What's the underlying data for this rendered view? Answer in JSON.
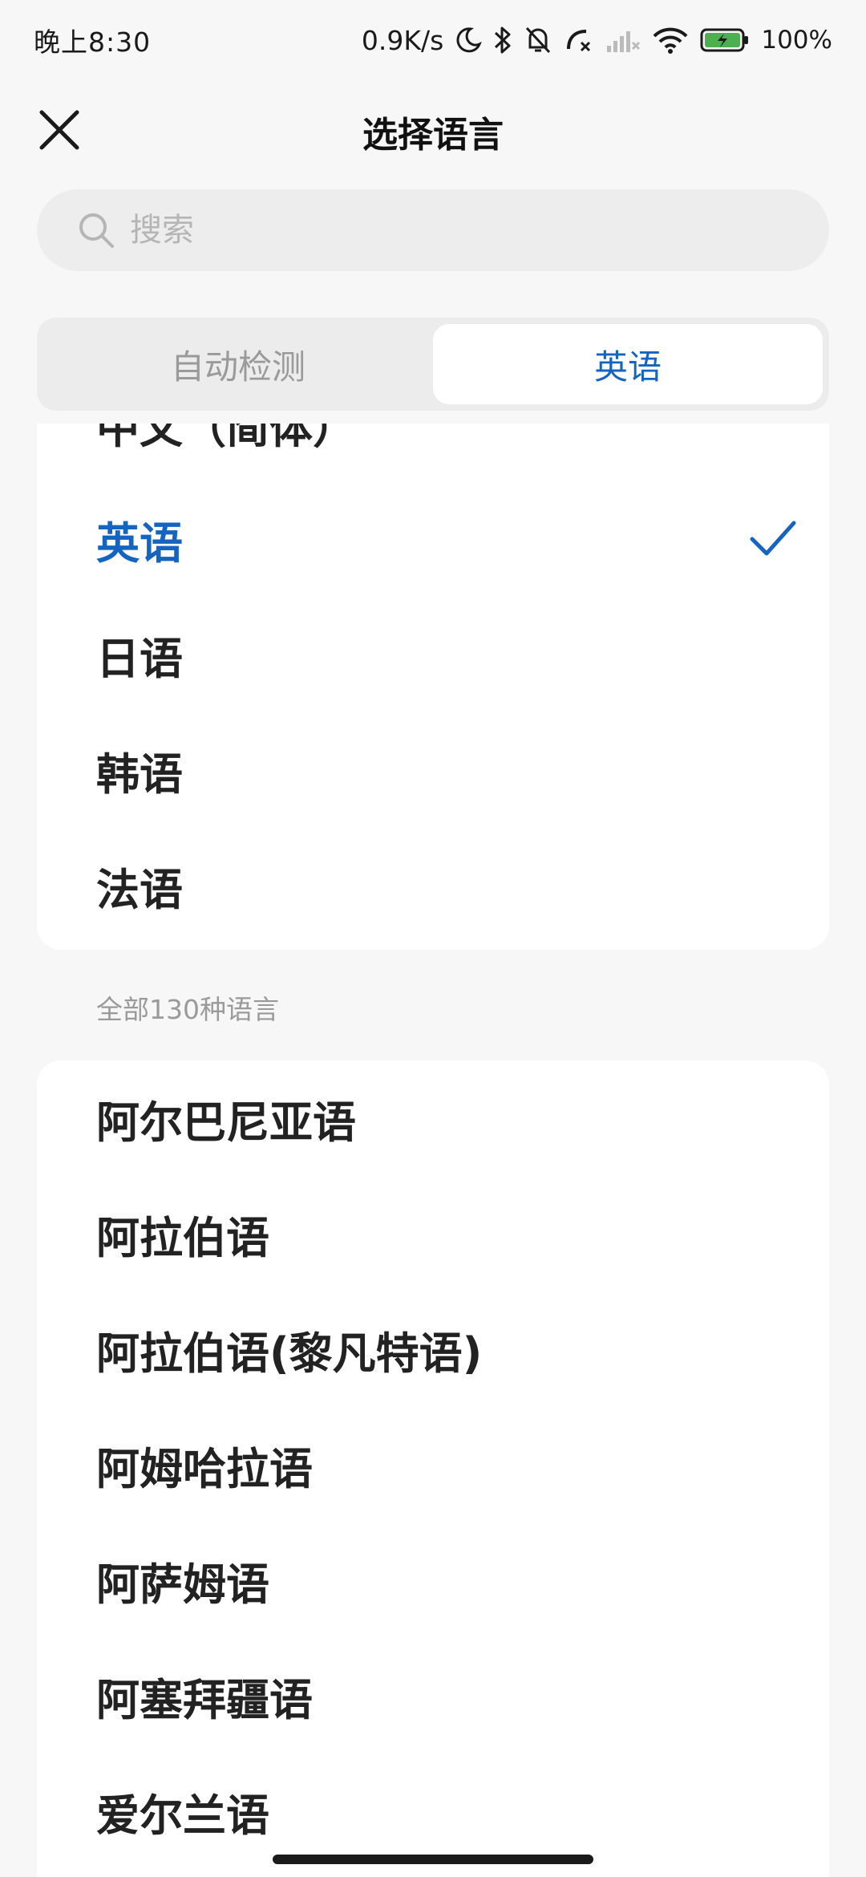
{
  "status_bar": {
    "time": "晚上8:30",
    "network_speed": "0.9K/s",
    "battery": "100%",
    "icons": [
      "moon-icon",
      "bluetooth-icon",
      "bell-muted-icon",
      "call-forward-icon",
      "signal-icon",
      "wifi-icon",
      "battery-charging-icon"
    ]
  },
  "header": {
    "title": "选择语言",
    "close_icon": "close-icon"
  },
  "search": {
    "placeholder": "搜索",
    "icon": "search-icon"
  },
  "tabs": [
    {
      "label": "自动检测",
      "active": false
    },
    {
      "label": "英语",
      "active": true
    }
  ],
  "recent_languages": [
    {
      "label": "中文（简体）",
      "selected": false
    },
    {
      "label": "英语",
      "selected": true
    },
    {
      "label": "日语",
      "selected": false
    },
    {
      "label": "韩语",
      "selected": false
    },
    {
      "label": "法语",
      "selected": false
    }
  ],
  "all_section": {
    "label": "全部130种语言"
  },
  "all_languages": [
    {
      "label": "阿尔巴尼亚语"
    },
    {
      "label": "阿拉伯语"
    },
    {
      "label": "阿拉伯语(黎凡特语)"
    },
    {
      "label": "阿姆哈拉语"
    },
    {
      "label": "阿萨姆语"
    },
    {
      "label": "阿塞拜疆语"
    },
    {
      "label": "爱尔兰语"
    }
  ],
  "colors": {
    "accent": "#1565c0",
    "background": "#f7f7f7",
    "card": "#ffffff"
  }
}
